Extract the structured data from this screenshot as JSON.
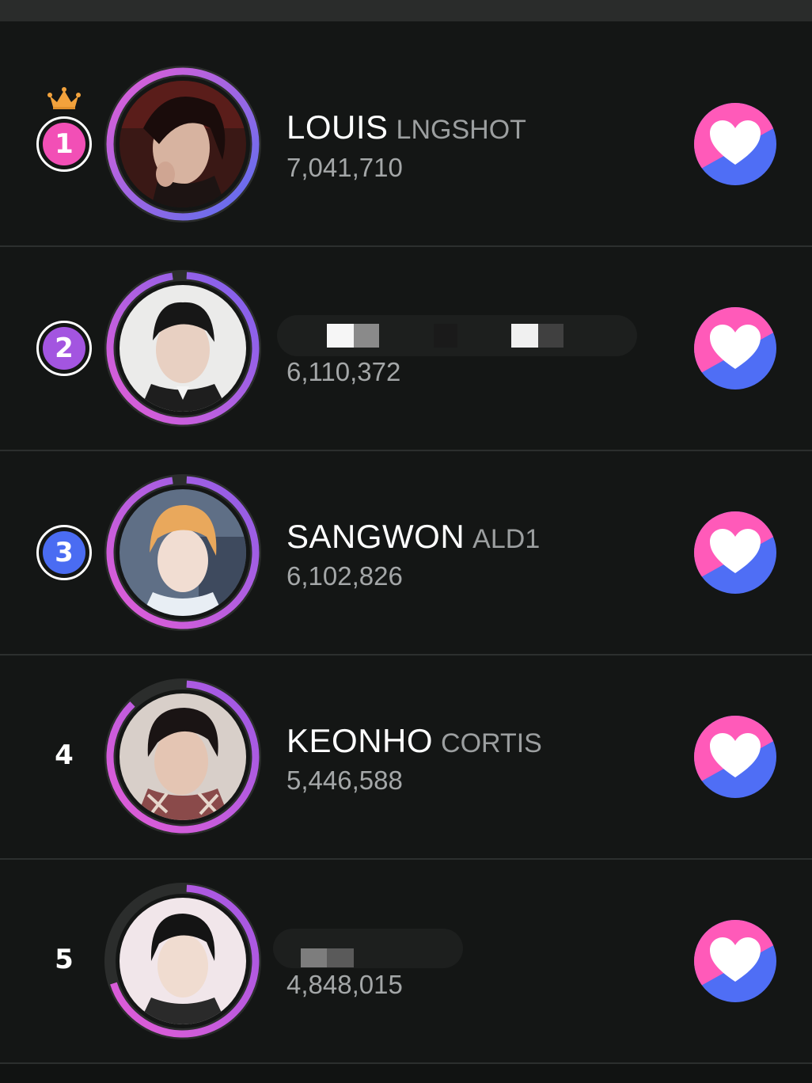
{
  "colors": {
    "background": "#141615",
    "rank1": "#f24fb6",
    "rank2": "#a355e0",
    "rank3": "#4a6cf2",
    "heart_pink": "#ff5ab9",
    "heart_blue": "#4f6ef5",
    "ring_start": "#e35dd6",
    "ring_end": "#5a6ff0"
  },
  "ranking": [
    {
      "rank": "1",
      "name": "LOUIS",
      "group": "LNGSHOT",
      "votes": "7,041,710",
      "crown": true,
      "progress": 1.0
    },
    {
      "rank": "2",
      "name": "",
      "group": "",
      "votes": "6,110,372",
      "crown": false,
      "progress": 0.97
    },
    {
      "rank": "3",
      "name": "SANGWON",
      "group": "ALD1",
      "votes": "6,102,826",
      "crown": false,
      "progress": 0.97
    },
    {
      "rank": "4",
      "name": "KEONHO",
      "group": "CORTIS",
      "votes": "5,446,588",
      "crown": false,
      "progress": 0.87
    },
    {
      "rank": "5",
      "name": "",
      "group": "",
      "votes": "4,848,015",
      "crown": false,
      "progress": 0.69
    }
  ],
  "icons": {
    "crown": "crown-icon",
    "heart": "heart-icon"
  }
}
